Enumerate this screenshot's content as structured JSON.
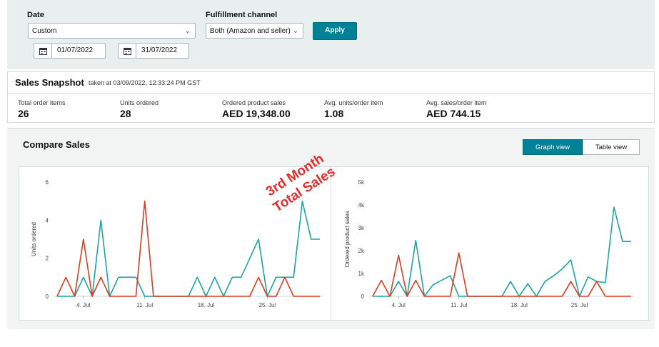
{
  "filters": {
    "date_label": "Date",
    "date_select": "Custom",
    "start_date": "01/07/2022",
    "end_date": "31/07/2022",
    "channel_label": "Fulfillment channel",
    "channel_select": "Both (Amazon and seller)",
    "apply_label": "Apply"
  },
  "snapshot": {
    "title": "Sales Snapshot",
    "timestamp": "taken at 03/09/2022, 12:33:24 PM GST",
    "metrics": [
      {
        "label": "Total order items",
        "value": "26"
      },
      {
        "label": "Units ordered",
        "value": "28"
      },
      {
        "label": "Ordered product sales",
        "value": "AED 19,348.00"
      },
      {
        "label": "Avg. units/order item",
        "value": "1.08"
      },
      {
        "label": "Avg. sales/order item",
        "value": "AED 744.15"
      }
    ]
  },
  "compare": {
    "title": "Compare Sales",
    "graph_view": "Graph view",
    "table_view": "Table view"
  },
  "annotation": {
    "line1": "3rd Month",
    "line2": "Total Sales"
  },
  "colors": {
    "teal": "#1ba3a6",
    "red": "#dd3a1f",
    "accent": "#008296"
  },
  "chart_data": [
    {
      "type": "line",
      "ylabel": "Units ordered",
      "ylim": [
        0,
        6
      ],
      "yticks": [
        "0",
        "2",
        "4",
        "6"
      ],
      "xticks": [
        "4. Jul",
        "11. Jul",
        "18. Jul",
        "25. Jul"
      ],
      "x": [
        1,
        2,
        3,
        4,
        5,
        6,
        7,
        8,
        9,
        10,
        11,
        12,
        13,
        14,
        15,
        16,
        17,
        18,
        19,
        20,
        21,
        22,
        23,
        24,
        25,
        26,
        27,
        28,
        29,
        30,
        31
      ],
      "series": [
        {
          "color": "#1ba3a6",
          "values": [
            0,
            0,
            0,
            1,
            0,
            4,
            0,
            1,
            1,
            1,
            0,
            0,
            0,
            0,
            0,
            0,
            1,
            0,
            1,
            0,
            1,
            1,
            2,
            3,
            0,
            1,
            1,
            1,
            5,
            3,
            3
          ]
        },
        {
          "color": "#dd3a1f",
          "values": [
            0,
            1,
            0,
            3,
            0,
            1,
            0,
            0,
            0,
            0,
            5,
            0,
            0,
            0,
            0,
            0,
            0,
            0,
            0,
            0,
            0,
            0,
            0,
            1,
            0,
            0,
            1,
            0,
            0,
            0,
            0
          ]
        }
      ]
    },
    {
      "type": "line",
      "ylabel": "Ordered product sales",
      "ylim": [
        0,
        5000
      ],
      "yticks": [
        "0",
        "1k",
        "2k",
        "3k",
        "4k",
        "5k"
      ],
      "xticks": [
        "4. Jul",
        "11. Jul",
        "18. Jul",
        "25. Jul"
      ],
      "x": [
        1,
        2,
        3,
        4,
        5,
        6,
        7,
        8,
        9,
        10,
        11,
        12,
        13,
        14,
        15,
        16,
        17,
        18,
        19,
        20,
        21,
        22,
        23,
        24,
        25,
        26,
        27,
        28,
        29,
        30,
        31
      ],
      "series": [
        {
          "color": "#1ba3a6",
          "values": [
            0,
            0,
            0,
            650,
            0,
            2450,
            0,
            500,
            700,
            900,
            0,
            0,
            0,
            0,
            0,
            0,
            650,
            0,
            550,
            0,
            650,
            900,
            1200,
            1600,
            0,
            850,
            650,
            600,
            3900,
            2400,
            2400
          ]
        },
        {
          "color": "#dd3a1f",
          "values": [
            0,
            700,
            0,
            1800,
            0,
            700,
            0,
            0,
            0,
            0,
            1900,
            0,
            0,
            0,
            0,
            0,
            0,
            0,
            0,
            0,
            0,
            0,
            0,
            650,
            0,
            0,
            650,
            0,
            0,
            0,
            0
          ]
        }
      ]
    }
  ]
}
